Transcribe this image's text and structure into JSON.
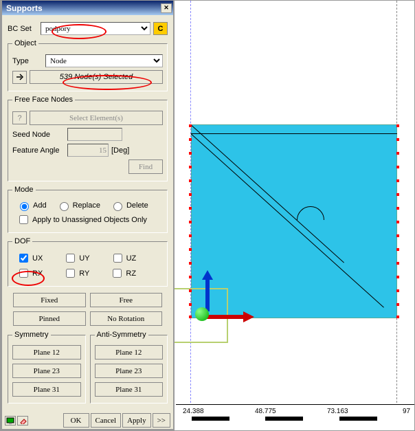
{
  "dialog": {
    "title": "Supports",
    "bcset_label": "BC Set",
    "bcset_value": "podpory",
    "object": {
      "legend": "Object",
      "type_label": "Type",
      "type_value": "Node",
      "selection_status": "539 Node(s) Selected"
    },
    "ffn": {
      "legend": "Free Face Nodes",
      "select_elements": "Select Element(s)",
      "seed_label": "Seed Node",
      "seed_value": "",
      "angle_label": "Feature Angle",
      "angle_value": "15",
      "angle_unit": "[Deg]",
      "find": "Find"
    },
    "mode": {
      "legend": "Mode",
      "add": "Add",
      "replace": "Replace",
      "delete": "Delete",
      "apply_unassigned": "Apply to Unassigned Objects Only"
    },
    "dof": {
      "legend": "DOF",
      "ux": "UX",
      "uy": "UY",
      "uz": "UZ",
      "rx": "RX",
      "ry": "RY",
      "rz": "RZ"
    },
    "buttons": {
      "fixed": "Fixed",
      "free": "Free",
      "pinned": "Pinned",
      "norot": "No Rotation"
    },
    "symmetry": {
      "legend": "Symmetry",
      "p12": "Plane 12",
      "p23": "Plane 23",
      "p31": "Plane 31"
    },
    "antisymmetry": {
      "legend": "Anti-Symmetry",
      "p12": "Plane 12",
      "p23": "Plane 23",
      "p31": "Plane 31"
    },
    "bottom": {
      "ok": "OK",
      "cancel": "Cancel",
      "apply": "Apply",
      "more": ">>"
    }
  },
  "viewport": {
    "ticks": [
      "24.388",
      "48.775",
      "73.163",
      "97"
    ]
  }
}
